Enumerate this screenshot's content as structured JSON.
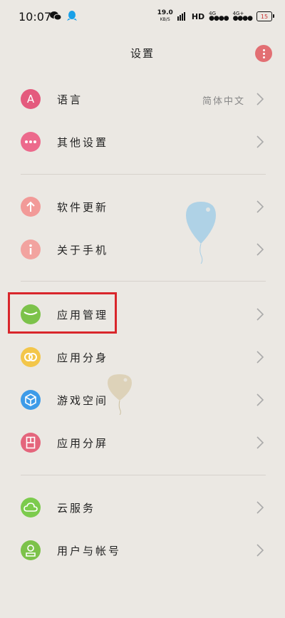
{
  "status_bar": {
    "time": "10:07",
    "net_speed_value": "19.0",
    "net_speed_unit": "KB/S",
    "hd_label": "HD",
    "network_1": "4G",
    "network_2": "4G+",
    "battery": "15"
  },
  "header": {
    "title": "设置"
  },
  "settings": {
    "language": {
      "label": "语言",
      "value": "简体中文"
    },
    "other": {
      "label": "其他设置"
    },
    "software_update": {
      "label": "软件更新"
    },
    "about_phone": {
      "label": "关于手机"
    },
    "app_management": {
      "label": "应用管理"
    },
    "app_clone": {
      "label": "应用分身"
    },
    "game_space": {
      "label": "游戏空间"
    },
    "split_screen": {
      "label": "应用分屏"
    },
    "cloud_service": {
      "label": "云服务"
    },
    "user_account": {
      "label": "用户与帐号"
    }
  },
  "colors": {
    "background": "#ebe8e3",
    "language_icon": "#e45a7d",
    "other_icon": "#ec6a8c",
    "update_icon": "#f29a98",
    "about_icon": "#f2a39f",
    "app_management_icon": "#7cc24a",
    "app_clone_icon": "#f3c64a",
    "game_space_icon": "#3d9be8",
    "split_screen_icon": "#e4657c",
    "cloud_icon": "#7ccb4d",
    "account_icon": "#7cc24a",
    "highlight": "#d9262b"
  },
  "icons": {
    "language": "letter-a-icon",
    "other": "ellipsis-icon",
    "software_update": "arrow-up-icon",
    "about_phone": "info-icon",
    "app_management": "bowl-icon",
    "app_clone": "double-circle-icon",
    "game_space": "cube-icon",
    "split_screen": "split-screen-icon",
    "cloud_service": "cloud-icon",
    "user_account": "person-icon"
  }
}
